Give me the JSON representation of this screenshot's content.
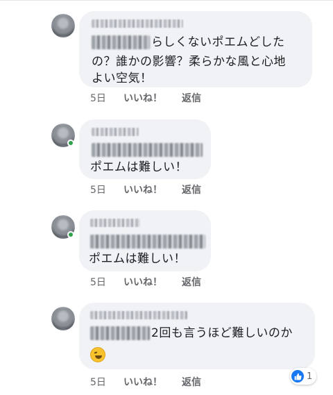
{
  "comments": [
    {
      "text_lines": [
        "らしくないポエムどした",
        "の？誰かの影響？柔らかな風と心地",
        "よい空気！"
      ],
      "time": "5日",
      "like": "いいね！",
      "reply": "返信",
      "online": false
    },
    {
      "text_lines": [
        "ポエムは難しい！"
      ],
      "time": "5日",
      "like": "いいね！",
      "reply": "返信",
      "online": true
    },
    {
      "text_lines": [
        "ポエムは難しい！"
      ],
      "time": "5日",
      "like": "いいね！",
      "reply": "返信",
      "online": true
    },
    {
      "text_lines": [
        "2回も言うほど難しいのか"
      ],
      "emoji": "rolling-on-floor-laughing",
      "time": "5日",
      "like": "いいね！",
      "reply": "返信",
      "online": false,
      "reaction_count": "1"
    }
  ],
  "colors": {
    "bubble": "#f0f2f5",
    "meta": "#65676b",
    "like_blue": "#1877f2",
    "online_green": "#31a24c"
  }
}
